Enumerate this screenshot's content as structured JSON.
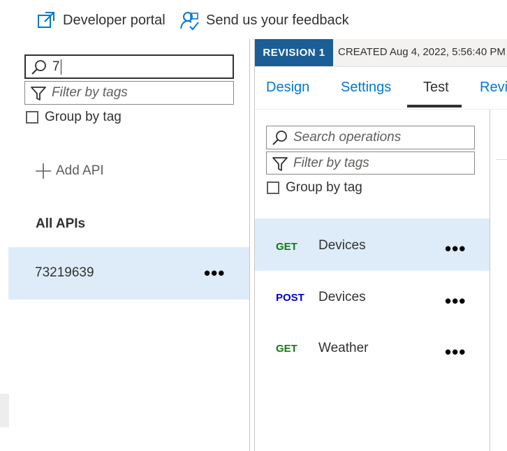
{
  "toolbar": {
    "developer_portal": "Developer portal",
    "feedback": "Send us your feedback"
  },
  "left_panel": {
    "search_value": "7",
    "filter_placeholder": "Filter by tags",
    "group_by_tag": "Group by tag",
    "add_api": "Add API",
    "all_apis": "All APIs",
    "apis": [
      {
        "name": "73219639",
        "selected": true
      }
    ]
  },
  "revision": {
    "badge": "REVISION 1",
    "created": "CREATED Aug 4, 2022, 5:56:40 PM"
  },
  "tabs": [
    {
      "label": "Design",
      "active": false
    },
    {
      "label": "Settings",
      "active": false
    },
    {
      "label": "Test",
      "active": true
    },
    {
      "label": "Revisi",
      "active": false
    }
  ],
  "ops_panel": {
    "search_placeholder": "Search operations",
    "filter_placeholder": "Filter by tags",
    "group_by_tag": "Group by tag",
    "operations": [
      {
        "method": "GET",
        "name": "Devices",
        "selected": true
      },
      {
        "method": "POST",
        "name": "Devices",
        "selected": false
      },
      {
        "method": "GET",
        "name": "Weather",
        "selected": false
      }
    ]
  },
  "colors": {
    "accent": "#0078d4",
    "get": "#107c10",
    "post": "#0000cc",
    "selected_bg": "#deecf9",
    "revision_badge": "#1b5e96"
  },
  "icons": [
    "external-link-icon",
    "feedback-icon",
    "search-icon",
    "filter-icon",
    "plus-icon",
    "more-icon"
  ]
}
